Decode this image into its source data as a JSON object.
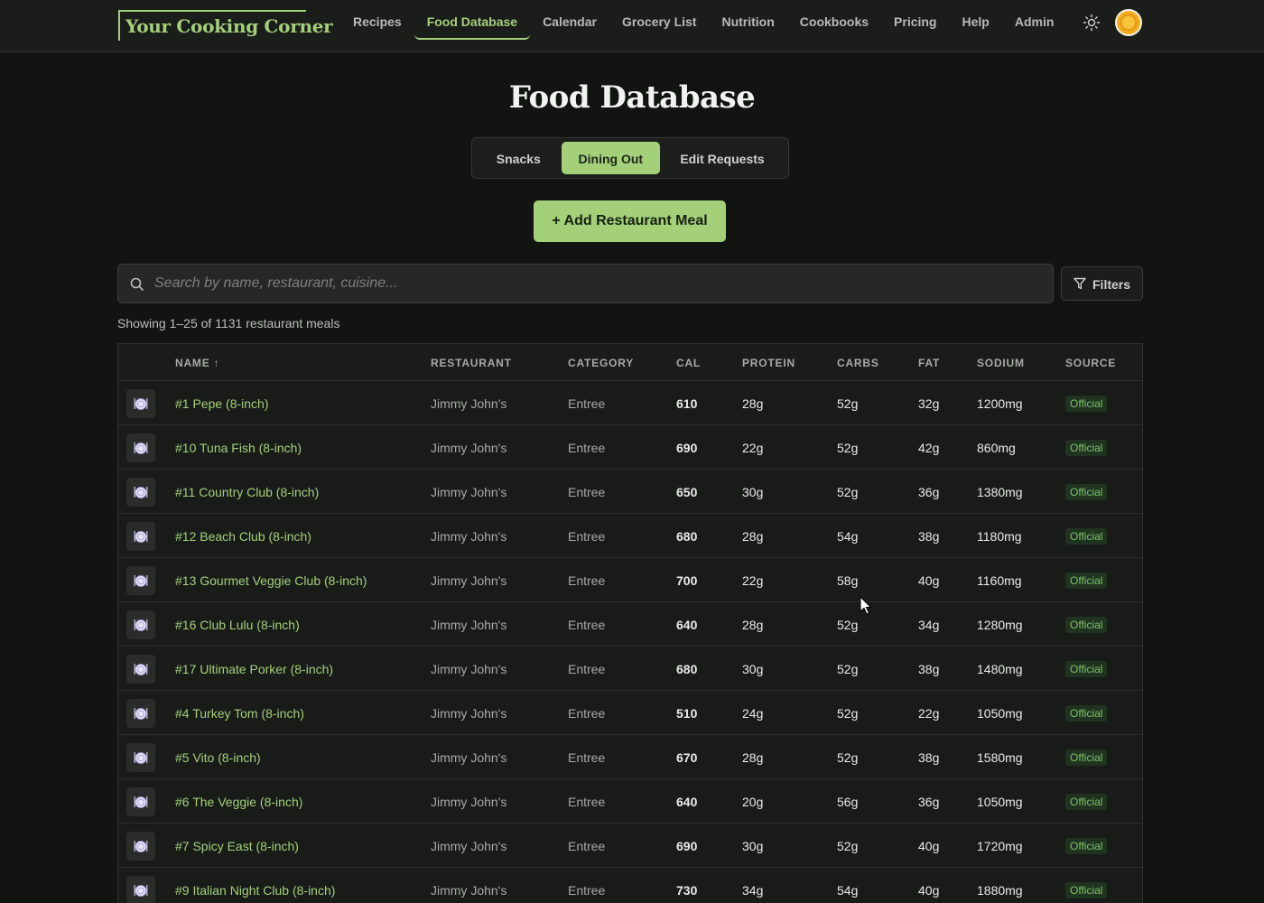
{
  "app": {
    "logo_text": "Your Cooking Corner",
    "accent_color": "#a4d07a"
  },
  "nav": {
    "items": [
      {
        "label": "Recipes",
        "active": false
      },
      {
        "label": "Food Database",
        "active": true
      },
      {
        "label": "Calendar",
        "active": false
      },
      {
        "label": "Grocery List",
        "active": false
      },
      {
        "label": "Nutrition",
        "active": false
      },
      {
        "label": "Cookbooks",
        "active": false
      },
      {
        "label": "Pricing",
        "active": false
      },
      {
        "label": "Help",
        "active": false
      },
      {
        "label": "Admin",
        "active": false
      }
    ],
    "theme_icon": "sun-icon",
    "avatar_icon": "avatar"
  },
  "page": {
    "title": "Food Database",
    "tabs": [
      {
        "label": "Snacks",
        "active": false
      },
      {
        "label": "Dining Out",
        "active": true
      },
      {
        "label": "Edit Requests",
        "active": false
      }
    ],
    "add_button_label": "+ Add Restaurant Meal"
  },
  "search": {
    "placeholder": "Search by name, restaurant, cuisine...",
    "value": "",
    "icon": "search-icon",
    "filters_label": "Filters",
    "filters_icon": "filter-icon"
  },
  "results": {
    "summary": "Showing 1–25 of 1131 restaurant meals"
  },
  "table": {
    "headers": {
      "name": "NAME",
      "sort_indicator": "↑",
      "restaurant": "RESTAURANT",
      "category": "CATEGORY",
      "cal": "CAL",
      "protein": "PROTEIN",
      "carbs": "CARBS",
      "fat": "FAT",
      "sodium": "SODIUM",
      "source": "SOURCE"
    },
    "row_icon": "dish-icon",
    "rows": [
      {
        "name": "#1 Pepe (8-inch)",
        "restaurant": "Jimmy John's",
        "category": "Entree",
        "cal": "610",
        "protein": "28g",
        "carbs": "52g",
        "fat": "32g",
        "sodium": "1200mg",
        "source": "Official"
      },
      {
        "name": "#10 Tuna Fish (8-inch)",
        "restaurant": "Jimmy John's",
        "category": "Entree",
        "cal": "690",
        "protein": "22g",
        "carbs": "52g",
        "fat": "42g",
        "sodium": "860mg",
        "source": "Official"
      },
      {
        "name": "#11 Country Club (8-inch)",
        "restaurant": "Jimmy John's",
        "category": "Entree",
        "cal": "650",
        "protein": "30g",
        "carbs": "52g",
        "fat": "36g",
        "sodium": "1380mg",
        "source": "Official"
      },
      {
        "name": "#12 Beach Club (8-inch)",
        "restaurant": "Jimmy John's",
        "category": "Entree",
        "cal": "680",
        "protein": "28g",
        "carbs": "54g",
        "fat": "38g",
        "sodium": "1180mg",
        "source": "Official"
      },
      {
        "name": "#13 Gourmet Veggie Club (8-inch)",
        "restaurant": "Jimmy John's",
        "category": "Entree",
        "cal": "700",
        "protein": "22g",
        "carbs": "58g",
        "fat": "40g",
        "sodium": "1160mg",
        "source": "Official"
      },
      {
        "name": "#16 Club Lulu (8-inch)",
        "restaurant": "Jimmy John's",
        "category": "Entree",
        "cal": "640",
        "protein": "28g",
        "carbs": "52g",
        "fat": "34g",
        "sodium": "1280mg",
        "source": "Official"
      },
      {
        "name": "#17 Ultimate Porker (8-inch)",
        "restaurant": "Jimmy John's",
        "category": "Entree",
        "cal": "680",
        "protein": "30g",
        "carbs": "52g",
        "fat": "38g",
        "sodium": "1480mg",
        "source": "Official"
      },
      {
        "name": "#4 Turkey Tom (8-inch)",
        "restaurant": "Jimmy John's",
        "category": "Entree",
        "cal": "510",
        "protein": "24g",
        "carbs": "52g",
        "fat": "22g",
        "sodium": "1050mg",
        "source": "Official"
      },
      {
        "name": "#5 Vito (8-inch)",
        "restaurant": "Jimmy John's",
        "category": "Entree",
        "cal": "670",
        "protein": "28g",
        "carbs": "52g",
        "fat": "38g",
        "sodium": "1580mg",
        "source": "Official"
      },
      {
        "name": "#6 The Veggie (8-inch)",
        "restaurant": "Jimmy John's",
        "category": "Entree",
        "cal": "640",
        "protein": "20g",
        "carbs": "56g",
        "fat": "36g",
        "sodium": "1050mg",
        "source": "Official"
      },
      {
        "name": "#7 Spicy East (8-inch)",
        "restaurant": "Jimmy John's",
        "category": "Entree",
        "cal": "690",
        "protein": "30g",
        "carbs": "52g",
        "fat": "40g",
        "sodium": "1720mg",
        "source": "Official"
      },
      {
        "name": "#9 Italian Night Club (8-inch)",
        "restaurant": "Jimmy John's",
        "category": "Entree",
        "cal": "730",
        "protein": "34g",
        "carbs": "54g",
        "fat": "40g",
        "sodium": "1880mg",
        "source": "Official"
      }
    ]
  }
}
